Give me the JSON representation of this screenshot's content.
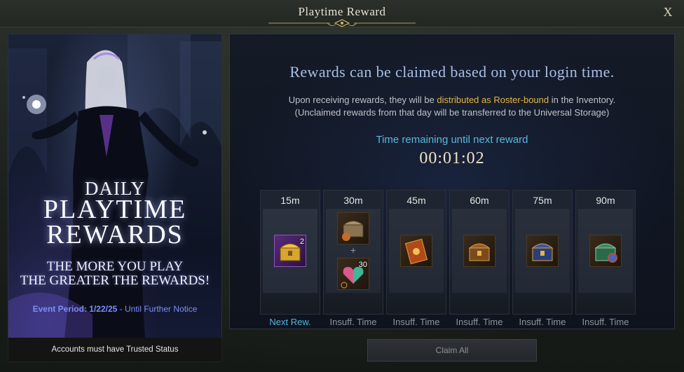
{
  "window": {
    "title": "Playtime Reward",
    "close_label": "X"
  },
  "banner": {
    "daily": "DAILY",
    "playtime": "PLAYTIME",
    "rewards": "REWARDS",
    "tagline_1": "THE MORE YOU PLAY",
    "tagline_2": "THE GREATER THE REWARDS!",
    "event_label": "Event Period: 1/22/25",
    "event_value": " - Until Further Notice",
    "trusted_note": "Accounts must have Trusted Status"
  },
  "panel": {
    "headline": "Rewards can be claimed based on your login time.",
    "desc_1_pre": "Upon receiving rewards, they will be ",
    "desc_1_highlight": "distributed as Roster-bound",
    "desc_1_post": " in the Inventory.",
    "desc_2": "(Unclaimed rewards from that day will be transferred to the Universal Storage)",
    "timer_label": "Time remaining until next reward",
    "timer_value": "00:01:02"
  },
  "rewards": [
    {
      "time": "15m",
      "status": "Next Rew.",
      "items": [
        {
          "icon": "golden-chest-icon",
          "qty": "2"
        }
      ]
    },
    {
      "time": "30m",
      "status": "Insuff. Time",
      "items": [
        {
          "icon": "material-chest-icon",
          "qty": ""
        },
        {
          "icon": "heart-crystal-icon",
          "qty": "30"
        }
      ]
    },
    {
      "time": "45m",
      "status": "Insuff. Time",
      "items": [
        {
          "icon": "card-pack-icon",
          "qty": ""
        }
      ]
    },
    {
      "time": "60m",
      "status": "Insuff. Time",
      "items": [
        {
          "icon": "ornate-chest-icon",
          "qty": ""
        }
      ]
    },
    {
      "time": "75m",
      "status": "Insuff. Time",
      "items": [
        {
          "icon": "blue-chest-icon",
          "qty": ""
        }
      ]
    },
    {
      "time": "90m",
      "status": "Insuff. Time",
      "items": [
        {
          "icon": "green-chest-icon",
          "qty": ""
        }
      ]
    }
  ],
  "footer": {
    "claim_all_label": "Claim All"
  },
  "colors": {
    "accent_blue": "#4fb6e0",
    "highlight_gold": "#e7b73d",
    "event_purple": "#7f8cff"
  }
}
